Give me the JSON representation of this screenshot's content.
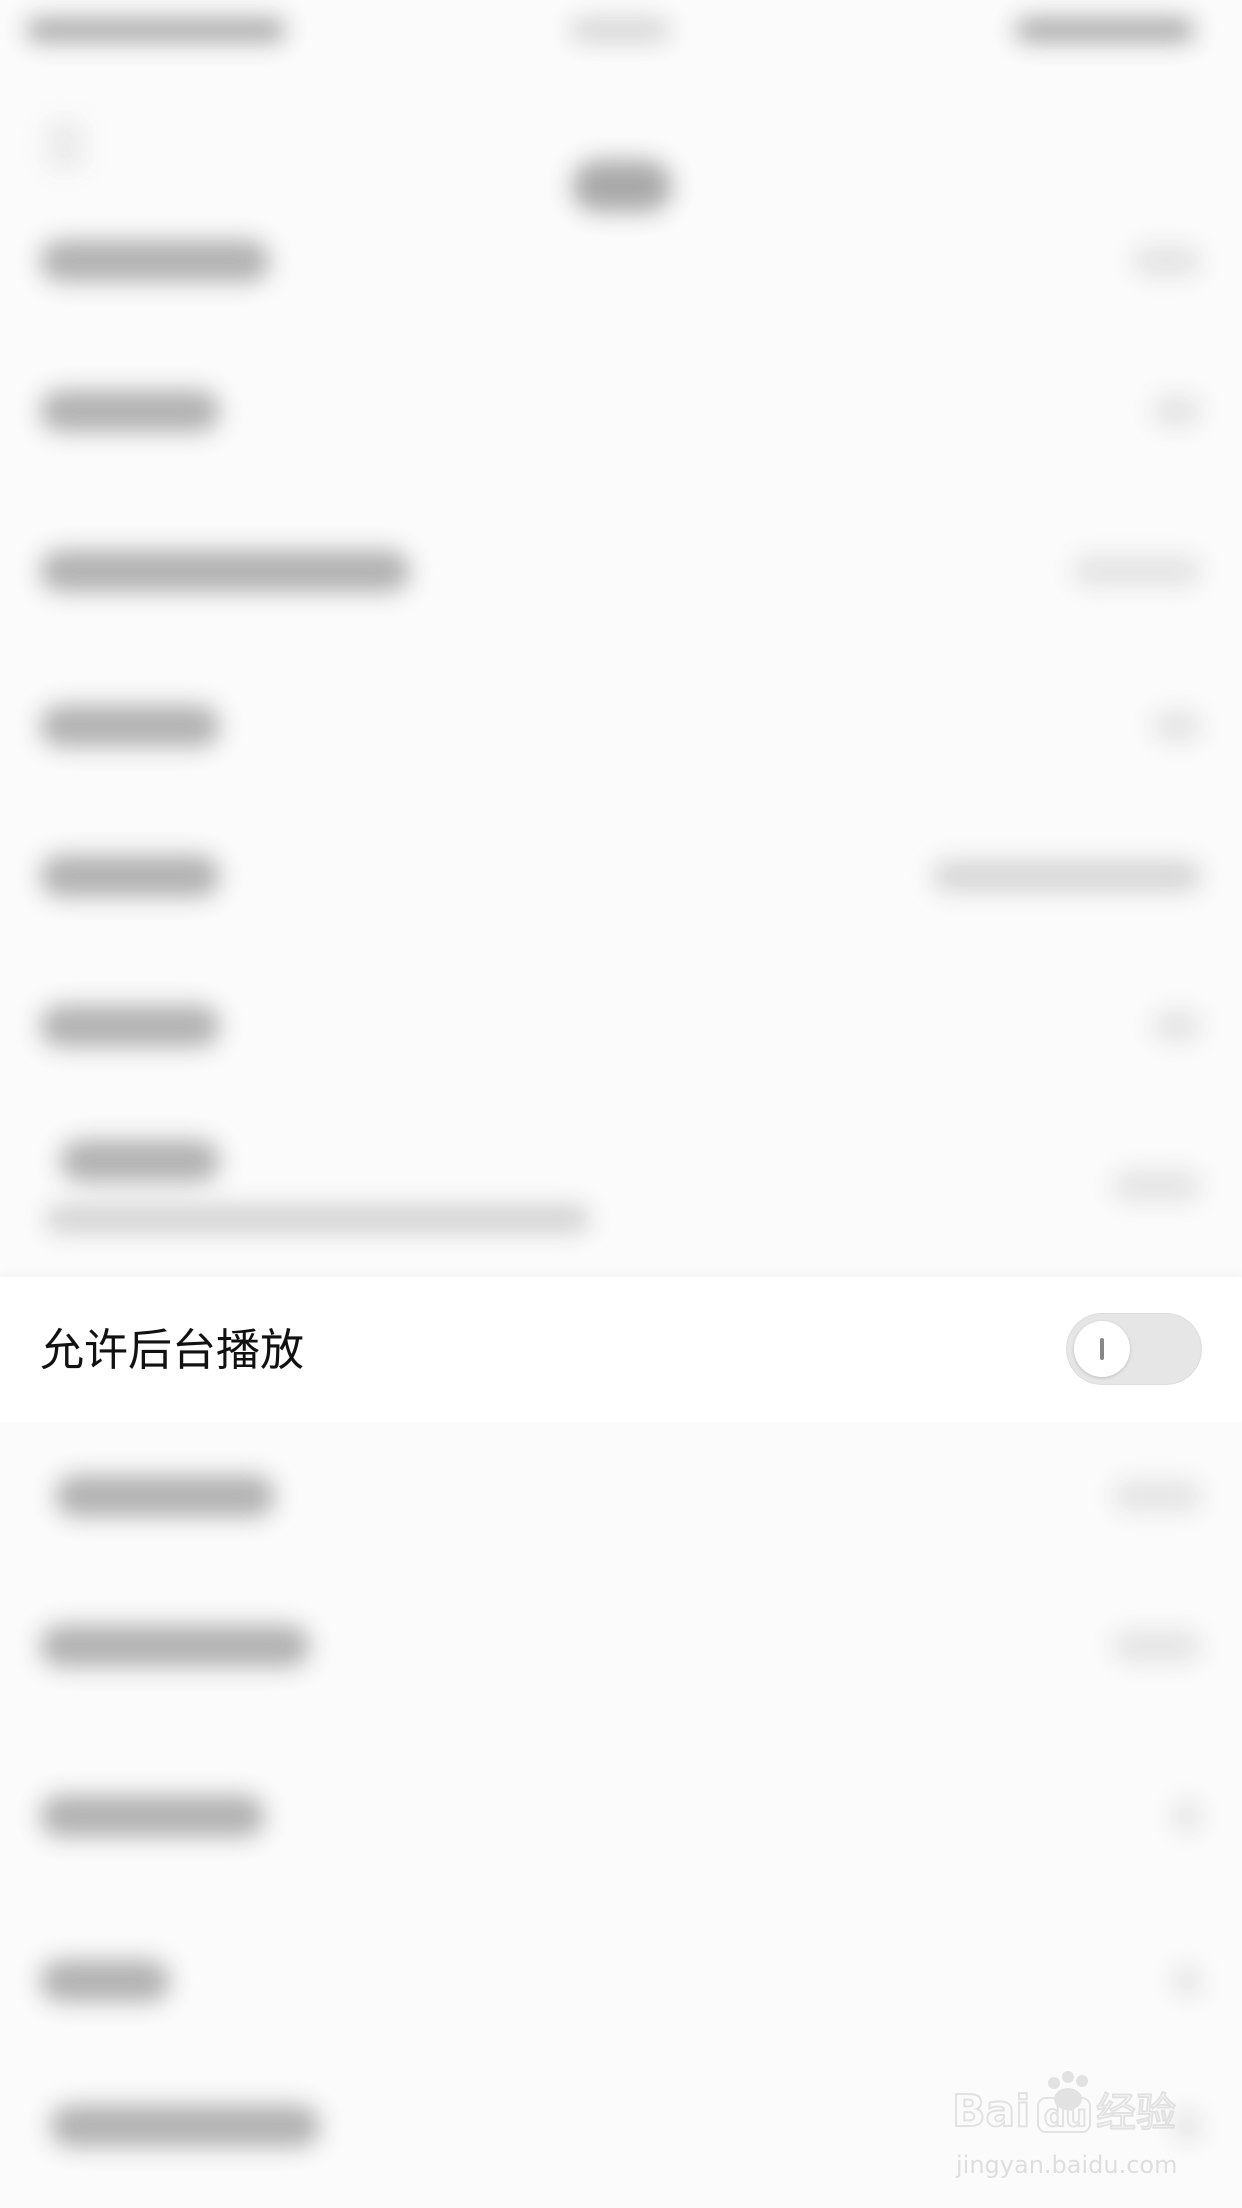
{
  "focused_setting": {
    "label": "允许后台播放",
    "toggle_state": "off"
  },
  "watermark": {
    "brand": "Baidu经验",
    "url": "jingyan.baidu.com"
  },
  "colors": {
    "background": "#fbfbfb",
    "focus_row_bg": "#ffffff",
    "label_text": "#111111",
    "toggle_off_track": "#e6e6e6"
  }
}
